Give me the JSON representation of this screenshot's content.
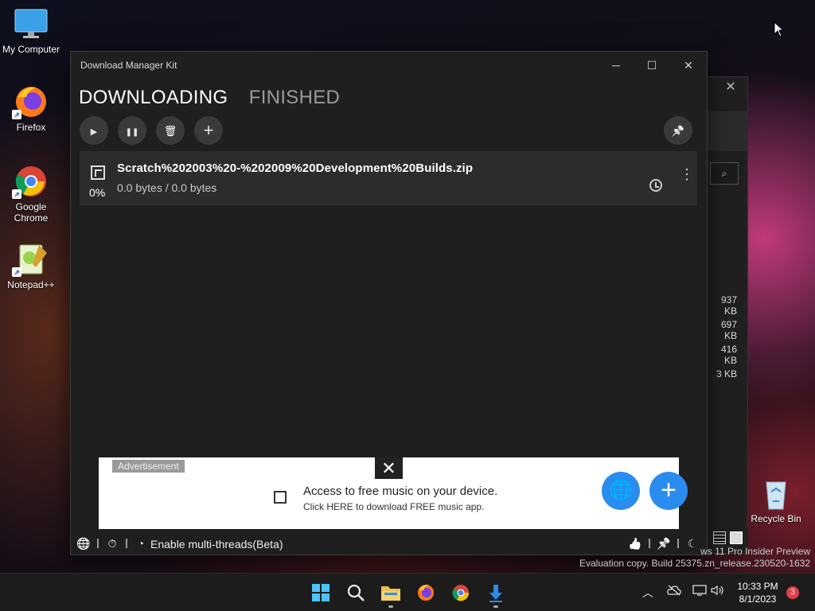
{
  "desktop": {
    "icons": [
      {
        "label": "My Computer"
      },
      {
        "label": "Firefox"
      },
      {
        "label": "Google Chrome"
      },
      {
        "label": "Notepad++"
      },
      {
        "label": "Recycle Bin"
      }
    ]
  },
  "background_window": {
    "close": "✕",
    "search_icon": "⌕",
    "sizes": [
      "937 KB",
      "697 KB",
      "416 KB",
      "3 KB"
    ]
  },
  "app": {
    "title": "Download Manager Kit",
    "window_controls": {
      "minimize": "─",
      "maximize": "☐",
      "close": "✕"
    },
    "tabs": [
      {
        "label": "DOWNLOADING",
        "active": true
      },
      {
        "label": "FINISHED",
        "active": false
      }
    ],
    "toolbar": {
      "play": "▶",
      "pause": "❚❚",
      "delete": "🗑",
      "add": "+",
      "pin": "📌"
    },
    "downloads": [
      {
        "filename": "Scratch%202003%20-%202009%20Development%20Builds.zip",
        "progress": "0%",
        "size_text": "0.0 bytes / 0.0 bytes",
        "more": "⋮"
      }
    ],
    "ad": {
      "label": "Advertisement",
      "close": "✕",
      "headline": "Access to free music on your device.",
      "subtext": "Click HERE to download FREE music app.",
      "globe": "🌐",
      "plus": "+"
    },
    "status_bar": {
      "globe": "🌐",
      "timer": "⏱",
      "speed": "◔",
      "multithread_label": "Enable multi-threads(Beta)",
      "like": "👍",
      "pin": "📌",
      "moon": "☾"
    }
  },
  "watermark": {
    "line1": "ws 11 Pro Insider Preview",
    "line2": "Evaluation copy. Build 25375.zn_release.230520-1632"
  },
  "taskbar": {
    "tray_chevron": "︿",
    "clock_time": "10:33 PM",
    "clock_date": "8/1/2023",
    "notification_count": "3"
  },
  "colors": {
    "accent": "#2b8cf0",
    "app_bg": "#1f1f1f",
    "item_bg": "#2c2c2c"
  }
}
